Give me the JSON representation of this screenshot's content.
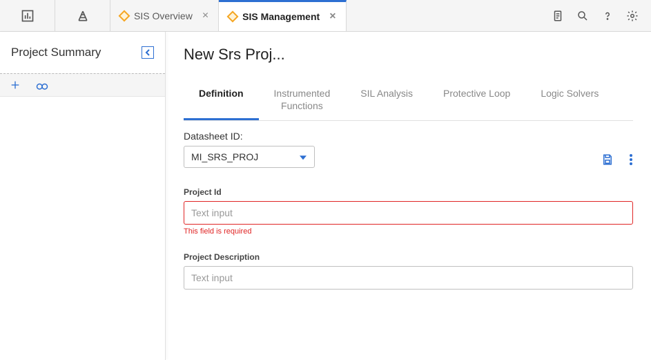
{
  "topbar": {
    "tabs": [
      {
        "label": "SIS Overview",
        "active": false
      },
      {
        "label": "SIS Management",
        "active": true
      }
    ]
  },
  "sidebar": {
    "title": "Project Summary"
  },
  "page": {
    "title": "New Srs Proj..."
  },
  "subtabs": [
    {
      "label": "Definition",
      "active": true
    },
    {
      "label": "Instrumented Functions",
      "active": false
    },
    {
      "label": "SIL Analysis",
      "active": false
    },
    {
      "label": "Protective Loop",
      "active": false
    },
    {
      "label": "Logic Solvers",
      "active": false
    }
  ],
  "datasheet": {
    "label": "Datasheet ID:",
    "selected": "MI_SRS_PROJ"
  },
  "fields": {
    "projectId": {
      "label": "Project Id",
      "placeholder": "Text input",
      "value": "",
      "error": "This field is required"
    },
    "projectDescription": {
      "label": "Project Description",
      "placeholder": "Text input",
      "value": ""
    }
  }
}
